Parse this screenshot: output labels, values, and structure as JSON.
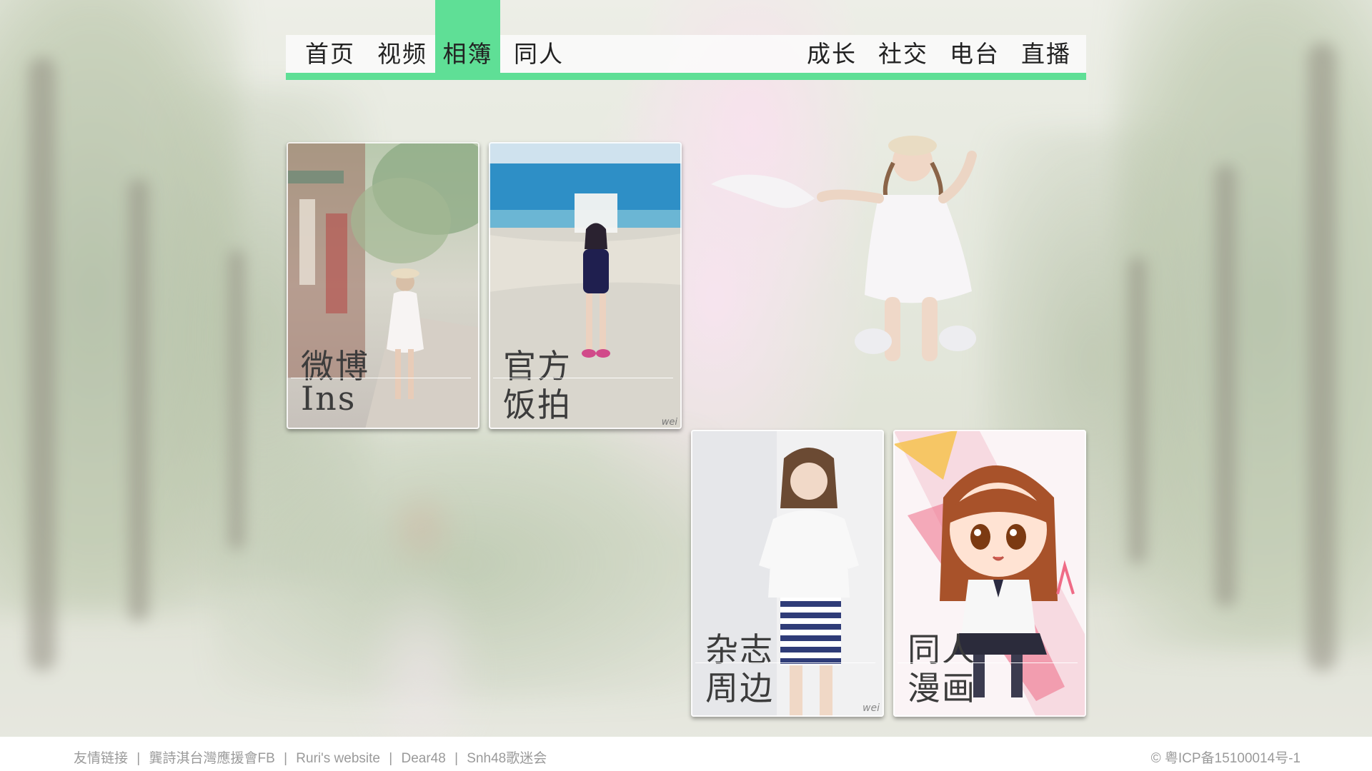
{
  "nav": {
    "left": [
      "首页",
      "视频",
      "相簿",
      "同人"
    ],
    "right": [
      "成长",
      "社交",
      "电台",
      "直播"
    ],
    "active": "相簿",
    "accent_color": "#5fdf96"
  },
  "cards": [
    {
      "line1": "微博",
      "line2": "Ins",
      "watermark": ""
    },
    {
      "line1": "官方",
      "line2": "饭拍",
      "watermark": "wei"
    },
    {
      "line1": "杂志",
      "line2": "周边",
      "watermark": "wei"
    },
    {
      "line1": "同人",
      "line2": "漫画",
      "watermark": ""
    }
  ],
  "footer": {
    "label": "友情链接",
    "links": [
      "龔詩淇台灣應援會FB",
      "Ruri's website",
      "Dear48",
      "Snh48歌迷会"
    ],
    "separator": "|",
    "copyright": "© 粤ICP备15100014号-1"
  }
}
